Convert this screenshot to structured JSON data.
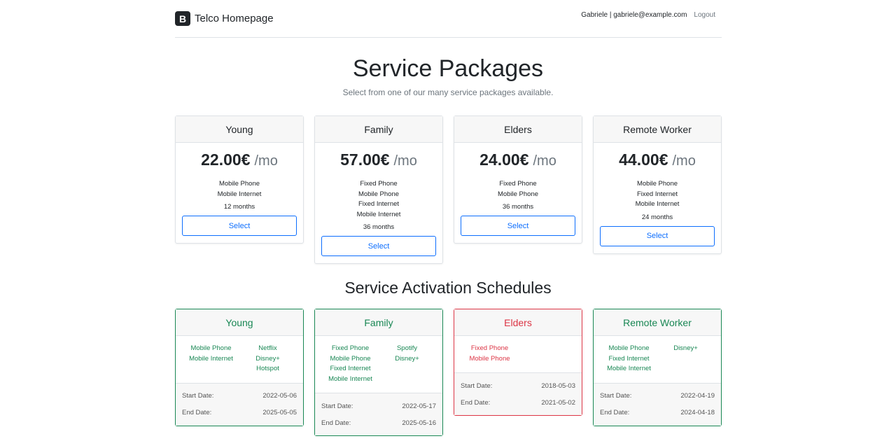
{
  "header": {
    "brand_logo": "B",
    "brand_name": "Telco Homepage",
    "user": "Gabriele | gabriele@example.com",
    "logout": "Logout"
  },
  "hero": {
    "title": "Service Packages",
    "subtitle": "Select from one of our many service packages available."
  },
  "packages": [
    {
      "name": "Young",
      "price": "22.00€",
      "per": "/mo",
      "services": [
        "Mobile Phone",
        "Mobile Internet"
      ],
      "duration": "12 months",
      "button": "Select"
    },
    {
      "name": "Family",
      "price": "57.00€",
      "per": "/mo",
      "services": [
        "Fixed Phone",
        "Mobile Phone",
        "Fixed Internet",
        "Mobile Internet"
      ],
      "duration": "36 months",
      "button": "Select"
    },
    {
      "name": "Elders",
      "price": "24.00€",
      "per": "/mo",
      "services": [
        "Fixed Phone",
        "Mobile Phone"
      ],
      "duration": "36 months",
      "button": "Select"
    },
    {
      "name": "Remote Worker",
      "price": "44.00€",
      "per": "/mo",
      "services": [
        "Mobile Phone",
        "Fixed Internet",
        "Mobile Internet"
      ],
      "duration": "24 months",
      "button": "Select"
    }
  ],
  "schedules_title": "Service Activation Schedules",
  "schedules": [
    {
      "name": "Young",
      "status": "active",
      "services": [
        "Mobile Phone",
        "Mobile Internet"
      ],
      "addons": [
        "Netflix",
        "Disney+",
        "Hotspot"
      ],
      "start_label": "Start Date:",
      "start": "2022-05-06",
      "end_label": "End Date:",
      "end": "2025-05-05"
    },
    {
      "name": "Family",
      "status": "active",
      "services": [
        "Fixed Phone",
        "Mobile Phone",
        "Fixed Internet",
        "Mobile Internet"
      ],
      "addons": [
        "Spotify",
        "Disney+"
      ],
      "start_label": "Start Date:",
      "start": "2022-05-17",
      "end_label": "End Date:",
      "end": "2025-05-16"
    },
    {
      "name": "Elders",
      "status": "expired",
      "services": [
        "Fixed Phone",
        "Mobile Phone"
      ],
      "addons": [],
      "start_label": "Start Date:",
      "start": "2018-05-03",
      "end_label": "End Date:",
      "end": "2021-05-02"
    },
    {
      "name": "Remote Worker",
      "status": "active",
      "services": [
        "Mobile Phone",
        "Fixed Internet",
        "Mobile Internet"
      ],
      "addons": [
        "Disney+"
      ],
      "start_label": "Start Date:",
      "start": "2022-04-19",
      "end_label": "End Date:",
      "end": "2024-04-18"
    }
  ],
  "colors": {
    "primary": "#0d6efd",
    "success": "#198754",
    "danger": "#dc3545",
    "muted": "#6c757d"
  }
}
